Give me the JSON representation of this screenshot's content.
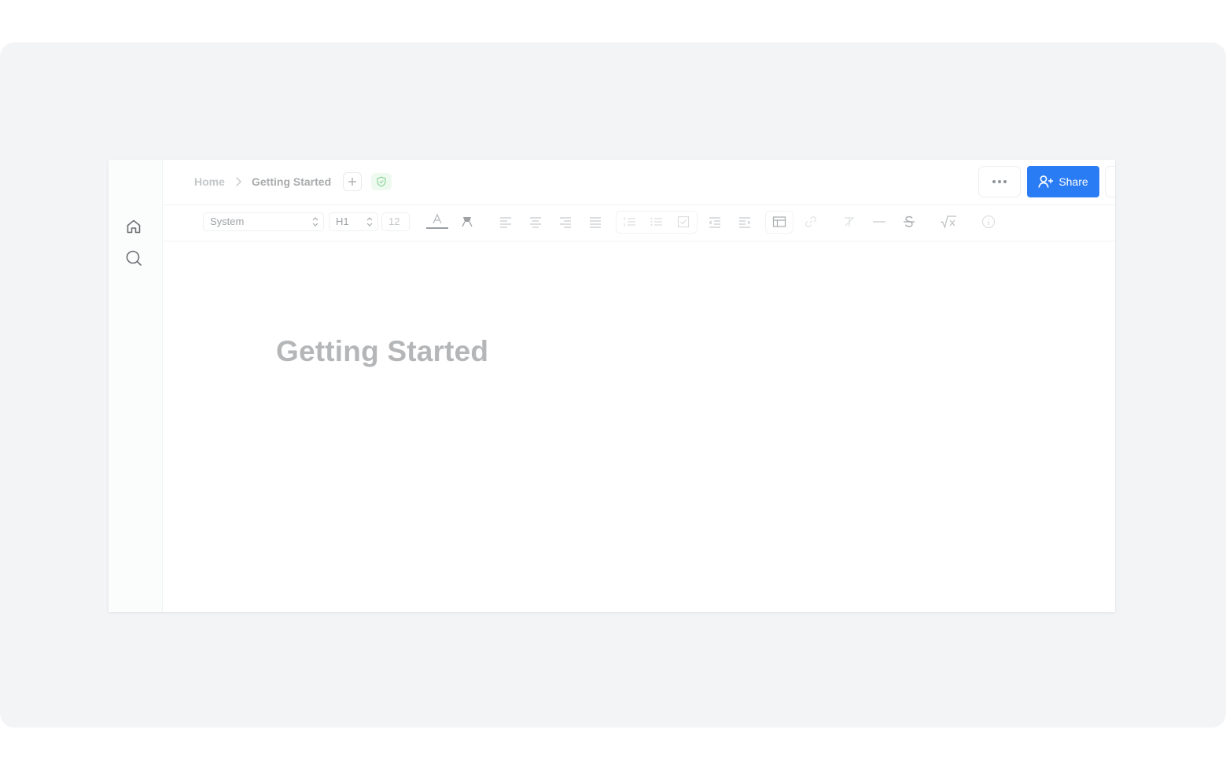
{
  "sidebar": {
    "icons": [
      "home-icon",
      "search-icon"
    ]
  },
  "breadcrumb": {
    "home": "Home",
    "current": "Getting Started"
  },
  "header": {
    "share_label": "Share"
  },
  "toolbar": {
    "font_family": "System",
    "block_style": "H1",
    "font_size": "12"
  },
  "document": {
    "title": "Getting Started"
  },
  "colors": {
    "accent": "#2a7cf4",
    "backdrop": "#f3f4f6",
    "shield": "#8fd49a"
  }
}
